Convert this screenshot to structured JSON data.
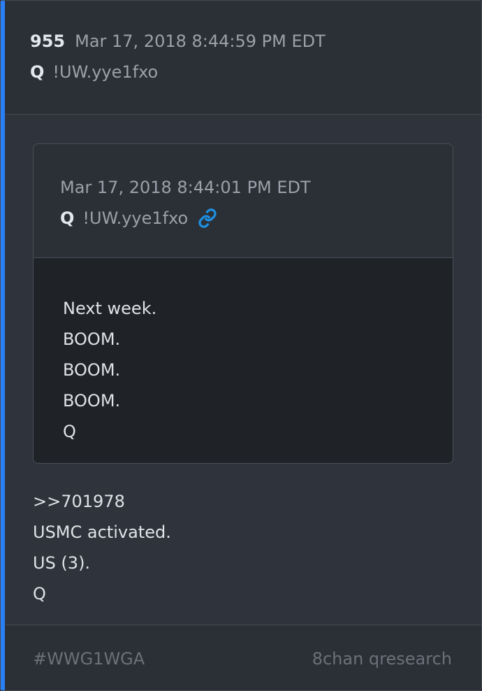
{
  "post": {
    "number": "955",
    "timestamp": "Mar 17, 2018 8:44:59 PM EDT",
    "author_name": "Q",
    "tripcode": "!UW.yye1fxo"
  },
  "quoted_post": {
    "timestamp": "Mar 17, 2018 8:44:01 PM EDT",
    "author_name": "Q",
    "tripcode": "!UW.yye1fxo",
    "link_icon": "link-icon",
    "lines": [
      "Next week.",
      "BOOM.",
      "BOOM.",
      "BOOM.",
      "Q"
    ]
  },
  "body": {
    "lines": [
      ">>701978",
      "USMC activated.",
      "US (3).",
      "Q"
    ]
  },
  "footer": {
    "hashtag": "#WWG1WGA",
    "source": "8chan qresearch"
  },
  "colors": {
    "accent": "#2a7ff5",
    "link": "#1e8fe0"
  }
}
